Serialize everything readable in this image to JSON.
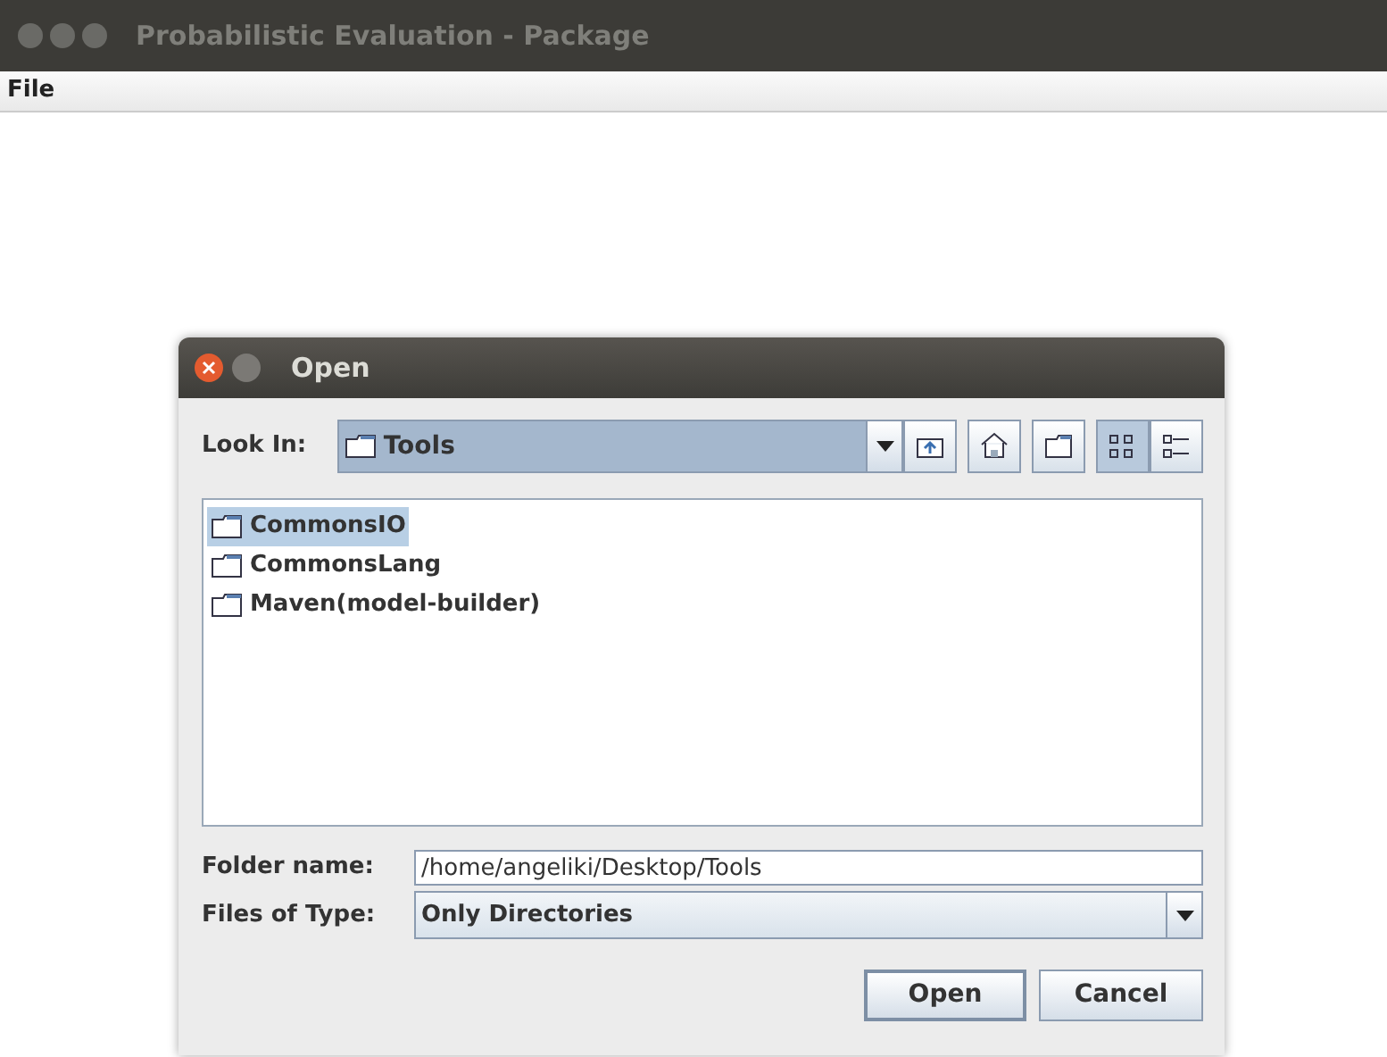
{
  "window": {
    "title": "Probabilistic Evaluation - Package"
  },
  "menu": [
    "File"
  ],
  "dialog": {
    "title": "Open",
    "look_in": {
      "label": "Look In:",
      "value": "Tools"
    },
    "toolbar": [
      {
        "kind": "up",
        "selected": false
      },
      {
        "kind": "home",
        "selected": false
      },
      {
        "kind": "new-folder",
        "selected": false
      },
      {
        "kind": "list",
        "selected": true
      },
      {
        "kind": "details",
        "selected": false
      }
    ],
    "files": [
      {
        "name": "CommonsIO",
        "selected": true
      },
      {
        "name": "CommonsLang",
        "selected": false
      },
      {
        "name": "Maven(model-builder)",
        "selected": false
      }
    ],
    "folder_name": {
      "label": "Folder name:",
      "value": "/home/angeliki/Desktop/Tools"
    },
    "files_of_type": {
      "label": "Files of Type:",
      "value": "Only Directories"
    },
    "buttons": [
      {
        "label": "Open",
        "default": true
      },
      {
        "label": "Cancel",
        "default": false
      }
    ]
  }
}
